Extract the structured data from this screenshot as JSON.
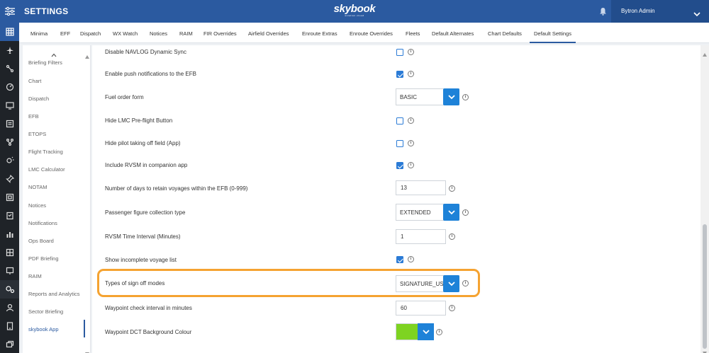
{
  "header": {
    "title": "SETTINGS",
    "logo": "skybook",
    "logo_tagline": "aviation cloud",
    "user_name": "Bytron Admin"
  },
  "tabs": [
    {
      "label": "Minima"
    },
    {
      "label": "EFF"
    },
    {
      "label": "Dispatch"
    },
    {
      "label": "WX Watch"
    },
    {
      "label": "Notices"
    },
    {
      "label": "RAIM"
    },
    {
      "label": "FIR Overrides"
    },
    {
      "label": "Airfield Overrides"
    },
    {
      "label": "Enroute Extras"
    },
    {
      "label": "Enroute Overrides"
    },
    {
      "label": "Fleets"
    },
    {
      "label": "Default Alternates"
    },
    {
      "label": "Chart Defaults"
    },
    {
      "label": "Default Settings",
      "active": true
    }
  ],
  "sidebar": {
    "items": [
      {
        "label": "Briefing Filters"
      },
      {
        "label": "Chart"
      },
      {
        "label": "Dispatch"
      },
      {
        "label": "EFB"
      },
      {
        "label": "ETOPS"
      },
      {
        "label": "Flight Tracking"
      },
      {
        "label": "LMC Calculator"
      },
      {
        "label": "NOTAM"
      },
      {
        "label": "Notices"
      },
      {
        "label": "Notifications"
      },
      {
        "label": "Ops Board"
      },
      {
        "label": "PDF Briefing"
      },
      {
        "label": "RAIM"
      },
      {
        "label": "Reports and Analytics"
      },
      {
        "label": "Sector Briefing"
      },
      {
        "label": "skybook App",
        "active": true
      }
    ]
  },
  "settings": [
    {
      "label": "Disable NAVLOG Dynamic Sync",
      "type": "checkbox",
      "checked": false
    },
    {
      "label": "Enable push notifications to the EFB",
      "type": "checkbox",
      "checked": true
    },
    {
      "label": "Fuel order form",
      "type": "select",
      "value": "BASIC"
    },
    {
      "label": "Hide LMC Pre-flight Button",
      "type": "checkbox",
      "checked": false
    },
    {
      "label": "Hide pilot taking off field (App)",
      "type": "checkbox",
      "checked": false
    },
    {
      "label": "Include RVSM in companion app",
      "type": "checkbox",
      "checked": true
    },
    {
      "label": "Number of days to retain voyages within the EFB (0-999)",
      "type": "number",
      "value": "13"
    },
    {
      "label": "Passenger figure collection type",
      "type": "select",
      "value": "EXTENDED"
    },
    {
      "label": "RVSM Time Interval (Minutes)",
      "type": "number",
      "value": "1"
    },
    {
      "label": "Show incomplete voyage list",
      "type": "checkbox",
      "checked": true
    },
    {
      "label": "Types of sign off modes",
      "type": "select",
      "value": "SIGNATURE_USER"
    },
    {
      "label": "Waypoint check interval in minutes",
      "type": "number",
      "value": "60"
    },
    {
      "label": "Waypoint DCT Background Colour",
      "type": "color",
      "value": "#7ed321"
    }
  ],
  "colors": {
    "header": "#2b5aa0",
    "accent": "#1e82d8",
    "highlight": "#f5a331"
  },
  "icons": {
    "info": "i"
  }
}
